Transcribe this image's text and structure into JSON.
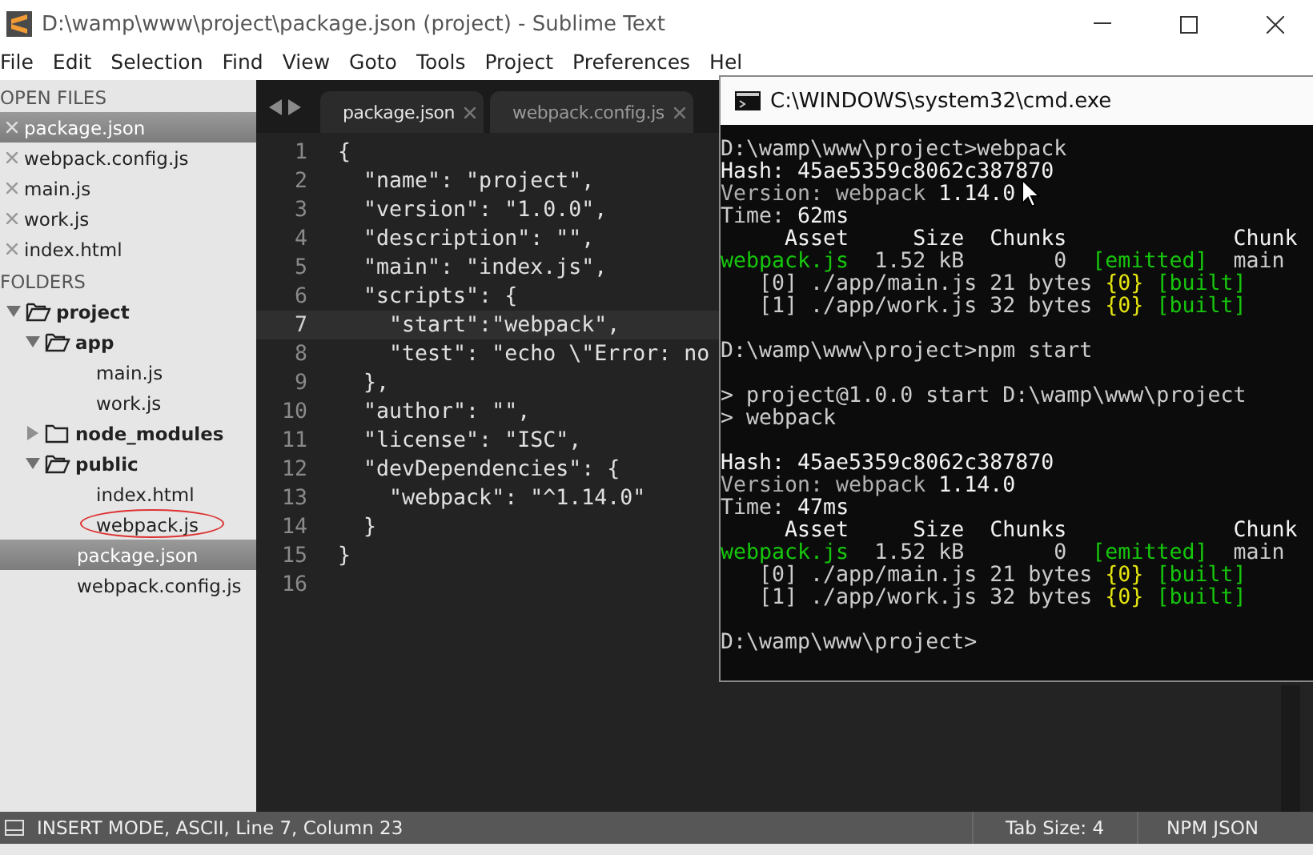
{
  "window": {
    "title": "D:\\wamp\\www\\project\\package.json (project) - Sublime Text"
  },
  "menu": [
    "File",
    "Edit",
    "Selection",
    "Find",
    "View",
    "Goto",
    "Tools",
    "Project",
    "Preferences",
    "Hel"
  ],
  "sidebar": {
    "open_files_heading": "OPEN FILES",
    "open_files": [
      {
        "label": "package.json",
        "selected": true
      },
      {
        "label": "webpack.config.js",
        "selected": false
      },
      {
        "label": "main.js",
        "selected": false
      },
      {
        "label": "work.js",
        "selected": false
      },
      {
        "label": "index.html",
        "selected": false
      }
    ],
    "folders_heading": "FOLDERS",
    "tree": [
      {
        "kind": "folder",
        "label": "project",
        "expanded": true,
        "selected": false,
        "circled": false,
        "children": [
          {
            "kind": "folder",
            "label": "app",
            "expanded": true,
            "selected": false,
            "circled": false,
            "children": [
              {
                "kind": "file",
                "label": "main.js",
                "selected": false,
                "circled": false
              },
              {
                "kind": "file",
                "label": "work.js",
                "selected": false,
                "circled": false
              }
            ]
          },
          {
            "kind": "folder",
            "label": "node_modules",
            "expanded": false,
            "selected": false,
            "circled": false
          },
          {
            "kind": "folder",
            "label": "public",
            "expanded": true,
            "selected": false,
            "circled": false,
            "children": [
              {
                "kind": "file",
                "label": "index.html",
                "selected": false,
                "circled": false
              },
              {
                "kind": "file",
                "label": "webpack.js",
                "selected": false,
                "circled": true
              }
            ]
          },
          {
            "kind": "file",
            "label": "package.json",
            "selected": true,
            "circled": false
          },
          {
            "kind": "file",
            "label": "webpack.config.js",
            "selected": false,
            "circled": false
          }
        ]
      }
    ]
  },
  "tabs": [
    {
      "label": "package.json",
      "selected": true
    },
    {
      "label": "webpack.config.js",
      "selected": false
    }
  ],
  "code": {
    "lines": [
      {
        "number": "1",
        "text": "{",
        "current": false
      },
      {
        "number": "2",
        "text": "  \"name\": \"project\",",
        "current": false
      },
      {
        "number": "3",
        "text": "  \"version\": \"1.0.0\",",
        "current": false
      },
      {
        "number": "4",
        "text": "  \"description\": \"\",",
        "current": false
      },
      {
        "number": "5",
        "text": "  \"main\": \"index.js\",",
        "current": false
      },
      {
        "number": "6",
        "text": "  \"scripts\": {",
        "current": false
      },
      {
        "number": "7",
        "text": "    \"start\":\"webpack\",",
        "current": true
      },
      {
        "number": "8",
        "text": "    \"test\": \"echo \\\"Error: no",
        "current": false
      },
      {
        "number": "9",
        "text": "  },",
        "current": false
      },
      {
        "number": "10",
        "text": "  \"author\": \"\",",
        "current": false
      },
      {
        "number": "11",
        "text": "  \"license\": \"ISC\",",
        "current": false
      },
      {
        "number": "12",
        "text": "  \"devDependencies\": {",
        "current": false
      },
      {
        "number": "13",
        "text": "    \"webpack\": \"^1.14.0\"",
        "current": false
      },
      {
        "number": "14",
        "text": "  }",
        "current": false
      },
      {
        "number": "15",
        "text": "}",
        "current": false
      },
      {
        "number": "16",
        "current": false
      }
    ]
  },
  "status_bar": {
    "mode": "INSERT MODE, ASCII, Line 7, Column 23",
    "tab_size": "Tab Size: 4",
    "syntax": "NPM JSON"
  },
  "terminal": {
    "title": "C:\\WINDOWS\\system32\\cmd.exe",
    "lines": [
      {
        "kind": "text",
        "segments": [
          {
            "text": "D:\\wamp\\www\\project>webpack",
            "color": "#cccccc"
          }
        ]
      },
      {
        "kind": "text",
        "segments": [
          {
            "text": "Hash: 45ae5359c8062c387870",
            "color": "#f2f2f2"
          }
        ]
      },
      {
        "kind": "text",
        "segments": [
          {
            "text": "Version: webpack ",
            "color": "#b0b0b0"
          },
          {
            "text": "1.14.0",
            "color": "#f2f2f2"
          }
        ]
      },
      {
        "kind": "text",
        "segments": [
          {
            "text": "Time: ",
            "color": "#cccccc"
          },
          {
            "text": "62ms",
            "color": "#f2f2f2"
          }
        ]
      },
      {
        "kind": "text",
        "segments": [
          {
            "text": "     Asset     Size  Chunks             Chunk",
            "color": "#f2f2f2"
          }
        ]
      },
      {
        "kind": "text",
        "segments": [
          {
            "text": "webpack.js",
            "color": "#16c60c"
          },
          {
            "text": "  1.52 kB       0  ",
            "color": "#cccccc"
          },
          {
            "text": "[emitted]",
            "color": "#16c60c"
          },
          {
            "text": "  main",
            "color": "#cccccc"
          }
        ]
      },
      {
        "kind": "text",
        "segments": [
          {
            "text": "   [0] ./app/main.js 21 bytes ",
            "color": "#cccccc"
          },
          {
            "text": "{0}",
            "color": "#e5e510"
          },
          {
            "text": " [built]",
            "color": "#16c60c"
          }
        ]
      },
      {
        "kind": "text",
        "segments": [
          {
            "text": "   [1] ./app/work.js 32 bytes ",
            "color": "#cccccc"
          },
          {
            "text": "{0}",
            "color": "#e5e510"
          },
          {
            "text": " [built]",
            "color": "#16c60c"
          }
        ]
      },
      {
        "kind": "blank"
      },
      {
        "kind": "text",
        "segments": [
          {
            "text": "D:\\wamp\\www\\project>npm start",
            "color": "#cccccc"
          }
        ]
      },
      {
        "kind": "blank"
      },
      {
        "kind": "text",
        "segments": [
          {
            "text": "> project@1.0.0 start D:\\wamp\\www\\project",
            "color": "#cccccc"
          }
        ]
      },
      {
        "kind": "text",
        "segments": [
          {
            "text": "> webpack",
            "color": "#cccccc"
          }
        ]
      },
      {
        "kind": "blank"
      },
      {
        "kind": "text",
        "segments": [
          {
            "text": "Hash: 45ae5359c8062c387870",
            "color": "#f2f2f2"
          }
        ]
      },
      {
        "kind": "text",
        "segments": [
          {
            "text": "Version: webpack ",
            "color": "#b0b0b0"
          },
          {
            "text": "1.14.0",
            "color": "#f2f2f2"
          }
        ]
      },
      {
        "kind": "text",
        "segments": [
          {
            "text": "Time: ",
            "color": "#cccccc"
          },
          {
            "text": "47ms",
            "color": "#f2f2f2"
          }
        ]
      },
      {
        "kind": "text",
        "segments": [
          {
            "text": "     Asset     Size  Chunks             Chunk",
            "color": "#f2f2f2"
          }
        ]
      },
      {
        "kind": "text",
        "segments": [
          {
            "text": "webpack.js",
            "color": "#16c60c"
          },
          {
            "text": "  1.52 kB       0  ",
            "color": "#cccccc"
          },
          {
            "text": "[emitted]",
            "color": "#16c60c"
          },
          {
            "text": "  main",
            "color": "#cccccc"
          }
        ]
      },
      {
        "kind": "text",
        "segments": [
          {
            "text": "   [0] ./app/main.js 21 bytes ",
            "color": "#cccccc"
          },
          {
            "text": "{0}",
            "color": "#e5e510"
          },
          {
            "text": " [built]",
            "color": "#16c60c"
          }
        ]
      },
      {
        "kind": "text",
        "segments": [
          {
            "text": "   [1] ./app/work.js 32 bytes ",
            "color": "#cccccc"
          },
          {
            "text": "{0}",
            "color": "#e5e510"
          },
          {
            "text": " [built]",
            "color": "#16c60c"
          }
        ]
      },
      {
        "kind": "blank"
      },
      {
        "kind": "text",
        "segments": [
          {
            "text": "D:\\wamp\\www\\project>",
            "color": "#cccccc"
          }
        ]
      }
    ]
  }
}
